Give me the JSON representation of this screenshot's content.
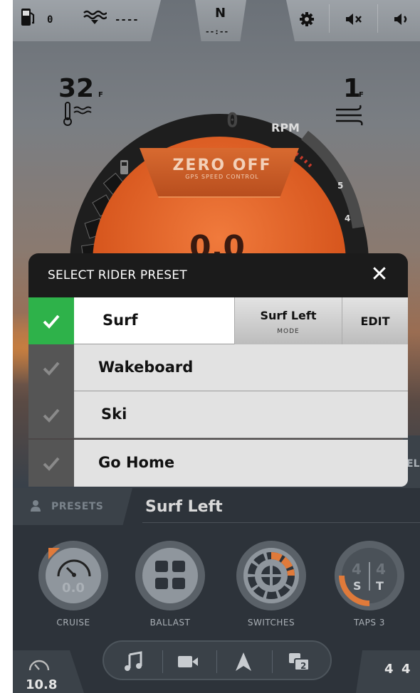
{
  "topbar": {
    "fuel_value": "0",
    "depth_value": "----",
    "heading": "N",
    "heading_sub": "--:--"
  },
  "gauge": {
    "water_temp": "32",
    "water_temp_unit": "F",
    "wind_speed": "1",
    "wind_unit": "F",
    "rpm_label": "RPM",
    "rpm_value": "0",
    "brand": "ZERO OFF",
    "brand_sub": "GPS SPEED CONTROL",
    "tick_5": "5",
    "tick_4": "4",
    "speed": "0.0"
  },
  "modal": {
    "title": "SELECT RIDER PRESET",
    "close_glyph": "✕",
    "presets": [
      {
        "label": "Surf",
        "selected": true,
        "mode_name": "Surf Left",
        "mode_sub": "MODE",
        "edit_label": "EDIT"
      },
      {
        "label": "Wakeboard",
        "selected": false
      },
      {
        "label": "Ski",
        "selected": false
      },
      {
        "label": "Go Home",
        "selected": false
      }
    ]
  },
  "bottom": {
    "presets_label": "PRESETS",
    "current_preset": "Surf Left",
    "buttons": [
      {
        "label": "CRUISE",
        "value": "0.0",
        "icon": "speedometer-icon"
      },
      {
        "label": "BALLAST",
        "icon": "ballast-icon"
      },
      {
        "label": "SWITCHES",
        "icon": "switches-icon"
      },
      {
        "label": "TAPS 3",
        "top_left": "4",
        "top_right": "4",
        "bottom_left": "S",
        "bottom_right": "T",
        "icon": "taps-icon"
      }
    ],
    "media": [
      "music-icon",
      "camera-icon",
      "navigation-icon",
      "screens-icon"
    ],
    "screens_number": "2",
    "speed_readout": "10.8",
    "taps_mini_left": "4",
    "taps_mini_right": "4",
    "side_tab_label": "EL"
  },
  "colors": {
    "active_check": "#2eb24a",
    "modal_header": "#1b1b1b",
    "gauge_orange": "#e0652a"
  }
}
